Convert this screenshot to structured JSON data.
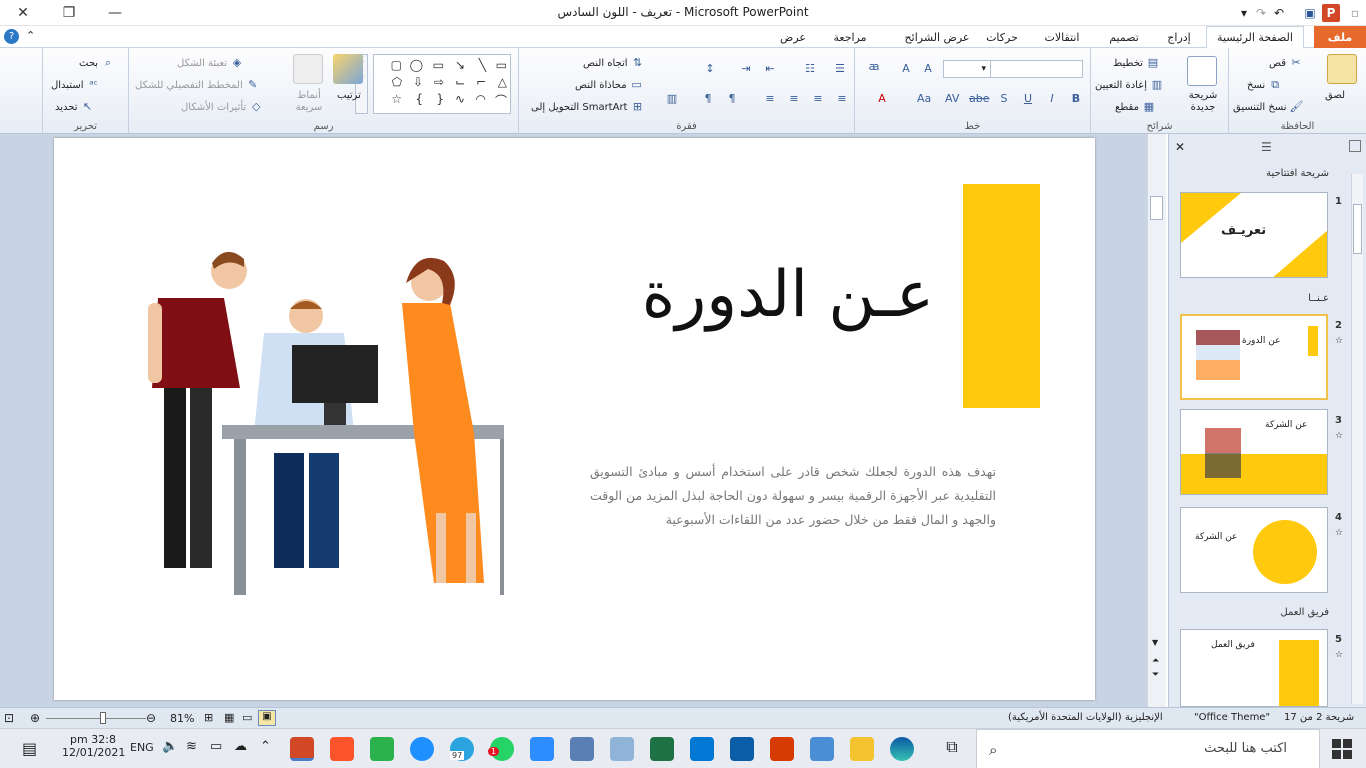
{
  "window": {
    "title": "تعريف - اللون السادس  -  Microsoft PowerPoint"
  },
  "tabs": [
    "ملف",
    "الصفحة الرئيسية",
    "إدراج",
    "تصميم",
    "انتقالات",
    "حركات",
    "عرض الشرائح",
    "مراجعة",
    "عرض"
  ],
  "ribbon": {
    "clipboard": {
      "label": "الحافظة",
      "paste": "لصق",
      "cut": "قص",
      "copy": "نسخ",
      "format_painter": "نسخ التنسيق"
    },
    "slides": {
      "label": "شرائح",
      "new_slide": "شريحة جديدة",
      "layout": "تخطيط",
      "reset": "إعادة التعيين",
      "section": "مقطع"
    },
    "font": {
      "label": "خط"
    },
    "paragraph": {
      "label": "فقرة",
      "text_direction": "اتجاه النص",
      "align_text": "محاذاة النص",
      "smartart": "التحويل إلى SmartArt"
    },
    "drawing": {
      "label": "رسم",
      "arrange": "ترتيب",
      "quick_styles": "أنماط سريعة",
      "shape_fill": "تعبئة الشكل",
      "shape_outline": "المخطط التفصيلي للشكل",
      "shape_effects": "تأثيرات الأشكال"
    },
    "editing": {
      "label": "تحرير",
      "find": "بحث",
      "replace": "استبدال",
      "select": "تحديد"
    }
  },
  "slide": {
    "title": "عـن الدورة",
    "body": "تهدف هذه الدورة لجعلك  شخص قادر على استخدام أسس و مبادئ التسويق التقليدية عبر الأجهزة الرقمية بيسر و سهولة دون الحاجة لبذل المزيد من الوقت والجهد و المال فقط من خلال حضور عدد من اللقاءات الأسبوعية",
    "accent_color": "#FFC90E"
  },
  "pane": {
    "sections": [
      "شريحة افتتاحية",
      "عـنــا",
      "فريق العمل"
    ],
    "slides": [
      {
        "num": "1",
        "title": "تعريـف"
      },
      {
        "num": "2",
        "title": "عن الدورة"
      },
      {
        "num": "3",
        "title": "عن الشركة"
      },
      {
        "num": "4",
        "title": "عن الشركة"
      },
      {
        "num": "5",
        "title": "فريق العمل"
      }
    ]
  },
  "status": {
    "slide_count": "شريحة 2 من 17",
    "theme": "\"Office Theme\"",
    "language": "الإنجليزية (الولايات المتحدة الأمريكية)",
    "zoom": "81%"
  },
  "taskbar": {
    "search_placeholder": "اكتب هنا للبحث",
    "time": "pm 32:8",
    "date": "12/01/2021",
    "lang": "ENG",
    "telegram_badge": "97",
    "whatsapp_badge": "1"
  }
}
